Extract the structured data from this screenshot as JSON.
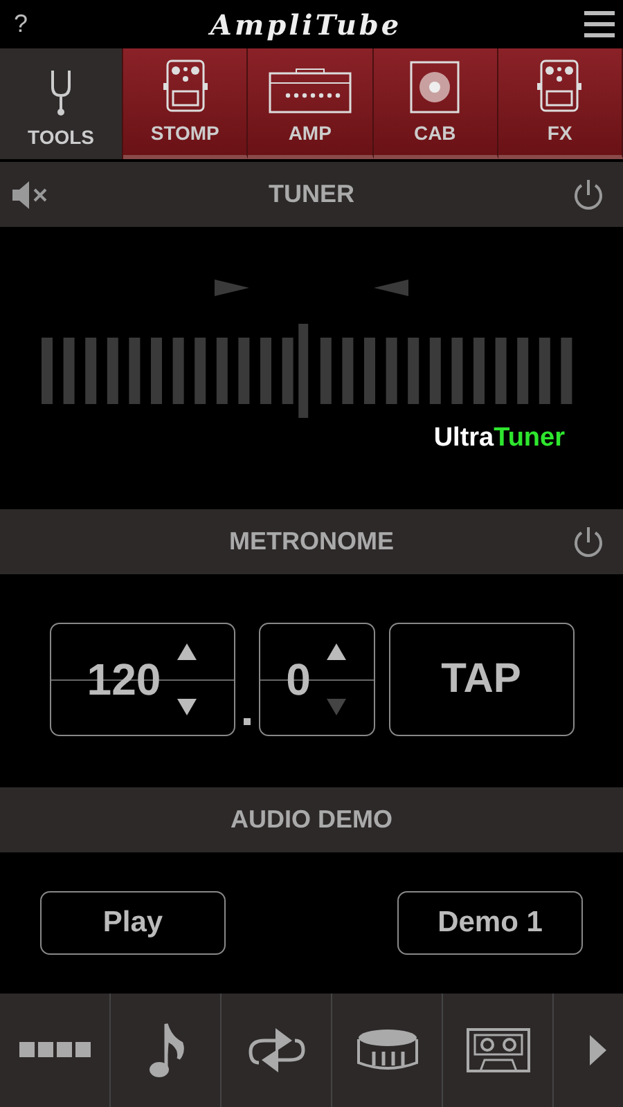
{
  "header": {
    "help": "?",
    "logo": "AmpliTube"
  },
  "tabs": [
    {
      "label": "TOOLS",
      "kind": "fork",
      "selected": true
    },
    {
      "label": "STOMP",
      "kind": "pedal",
      "selected": false
    },
    {
      "label": "AMP",
      "kind": "amp",
      "selected": false
    },
    {
      "label": "CAB",
      "kind": "cab",
      "selected": false
    },
    {
      "label": "FX",
      "kind": "pedal",
      "selected": false
    }
  ],
  "tuner": {
    "title": "TUNER",
    "muted": true,
    "brand_first": "Ultra",
    "brand_second": "Tuner"
  },
  "metronome": {
    "title": "METRONOME",
    "steppers": [
      {
        "value": "120",
        "up_disabled": false,
        "down_disabled": false
      },
      {
        "value": "0",
        "up_disabled": false,
        "down_disabled": true
      }
    ],
    "tap": "TAP"
  },
  "audio_demo": {
    "title": "AUDIO DEMO",
    "play": "Play",
    "demo": "Demo 1"
  },
  "toolbar": [
    {
      "kind": "grid"
    },
    {
      "kind": "note"
    },
    {
      "kind": "loop"
    },
    {
      "kind": "drum"
    },
    {
      "kind": "tape"
    },
    {
      "kind": "next"
    }
  ]
}
